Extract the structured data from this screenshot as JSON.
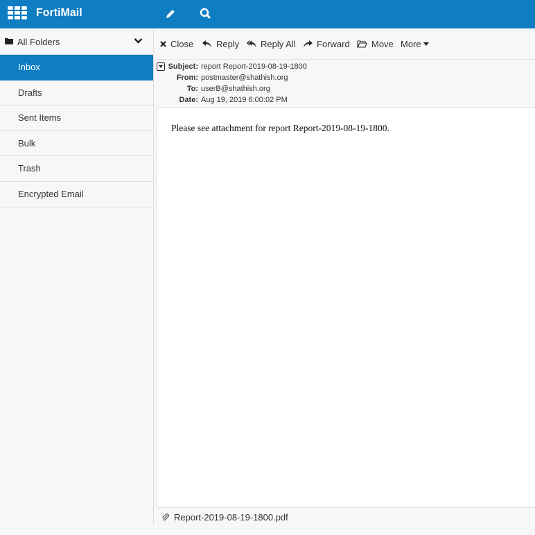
{
  "app": {
    "title": "FortiMail"
  },
  "sidebar": {
    "header": "All Folders",
    "items": [
      {
        "label": "Inbox",
        "active": true
      },
      {
        "label": "Drafts"
      },
      {
        "label": "Sent Items"
      },
      {
        "label": "Bulk"
      },
      {
        "label": "Trash"
      },
      {
        "label": "Encrypted Email"
      }
    ]
  },
  "toolbar": {
    "close": "Close",
    "reply": "Reply",
    "reply_all": "Reply All",
    "forward": "Forward",
    "move": "Move",
    "more": "More"
  },
  "message": {
    "subject_label": "Subject:",
    "subject": "report Report-2019-08-19-1800",
    "from_label": "From:",
    "from": "postmaster@shathish.org",
    "to_label": "To:",
    "to": "userB@shathish.org",
    "date_label": "Date:",
    "date": "Aug 19, 2019 6:00:02 PM",
    "body": "Please see attachment for report Report-2019-08-19-1800.",
    "attachment": "Report-2019-08-19-1800.pdf"
  },
  "colors": {
    "brand": "#0f7dc2"
  }
}
